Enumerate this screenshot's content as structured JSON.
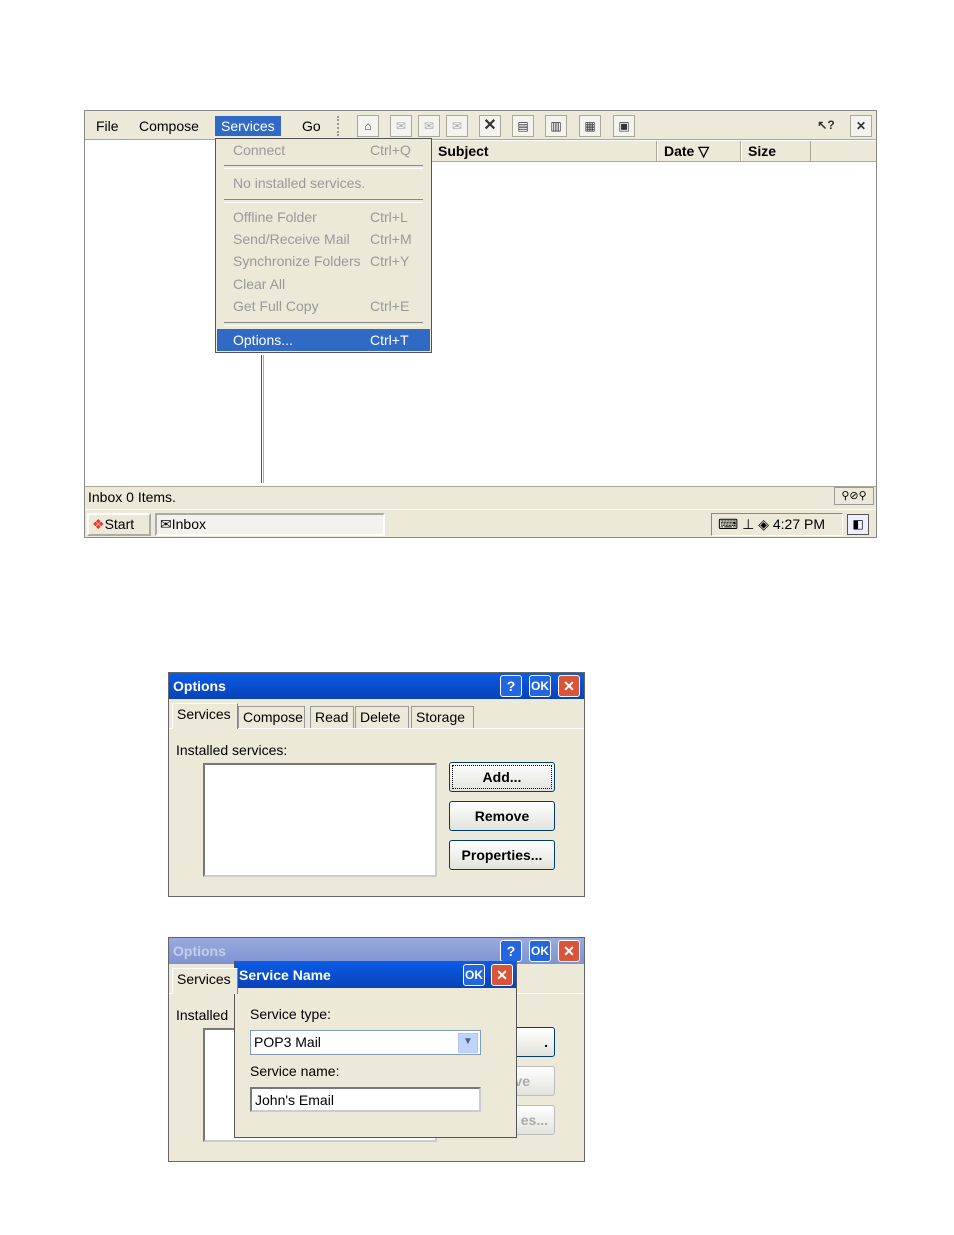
{
  "inbox": {
    "menus": [
      "File",
      "Compose",
      "Services",
      "Go"
    ],
    "columns": [
      "Subject",
      "Date ▽",
      "Size"
    ],
    "status": "Inbox 0 Items.",
    "start_label": "Start",
    "taskbar_item": "Inbox",
    "clock": "4:27 PM"
  },
  "services_menu": {
    "items": [
      {
        "label": "Connect",
        "shortcut": "Ctrl+Q"
      },
      {
        "label": "No installed services.",
        "shortcut": ""
      },
      {
        "label": "Offline Folder",
        "shortcut": "Ctrl+L"
      },
      {
        "label": "Send/Receive Mail",
        "shortcut": "Ctrl+M"
      },
      {
        "label": "Synchronize Folders",
        "shortcut": "Ctrl+Y"
      },
      {
        "label": "Clear All",
        "shortcut": ""
      },
      {
        "label": "Get Full Copy",
        "shortcut": "Ctrl+E"
      },
      {
        "label": "Options...",
        "shortcut": "Ctrl+T"
      }
    ]
  },
  "options": {
    "title": "Options",
    "tabs": [
      "Services",
      "Compose",
      "Read",
      "Delete",
      "Storage"
    ],
    "installed_label": "Installed services:",
    "add": "Add...",
    "remove": "Remove",
    "properties": "Properties..."
  },
  "options_partial": {
    "tab": "Services",
    "installed": "Installed",
    "add_frag": ".",
    "remove_frag": "ve",
    "props_frag": "es..."
  },
  "service_name": {
    "title": "Service Name",
    "type_label": "Service type:",
    "type_value": "POP3 Mail",
    "name_label": "Service name:",
    "name_value": "John's Email"
  },
  "titlebar": {
    "help": "?",
    "ok": "OK",
    "close": "✕"
  }
}
